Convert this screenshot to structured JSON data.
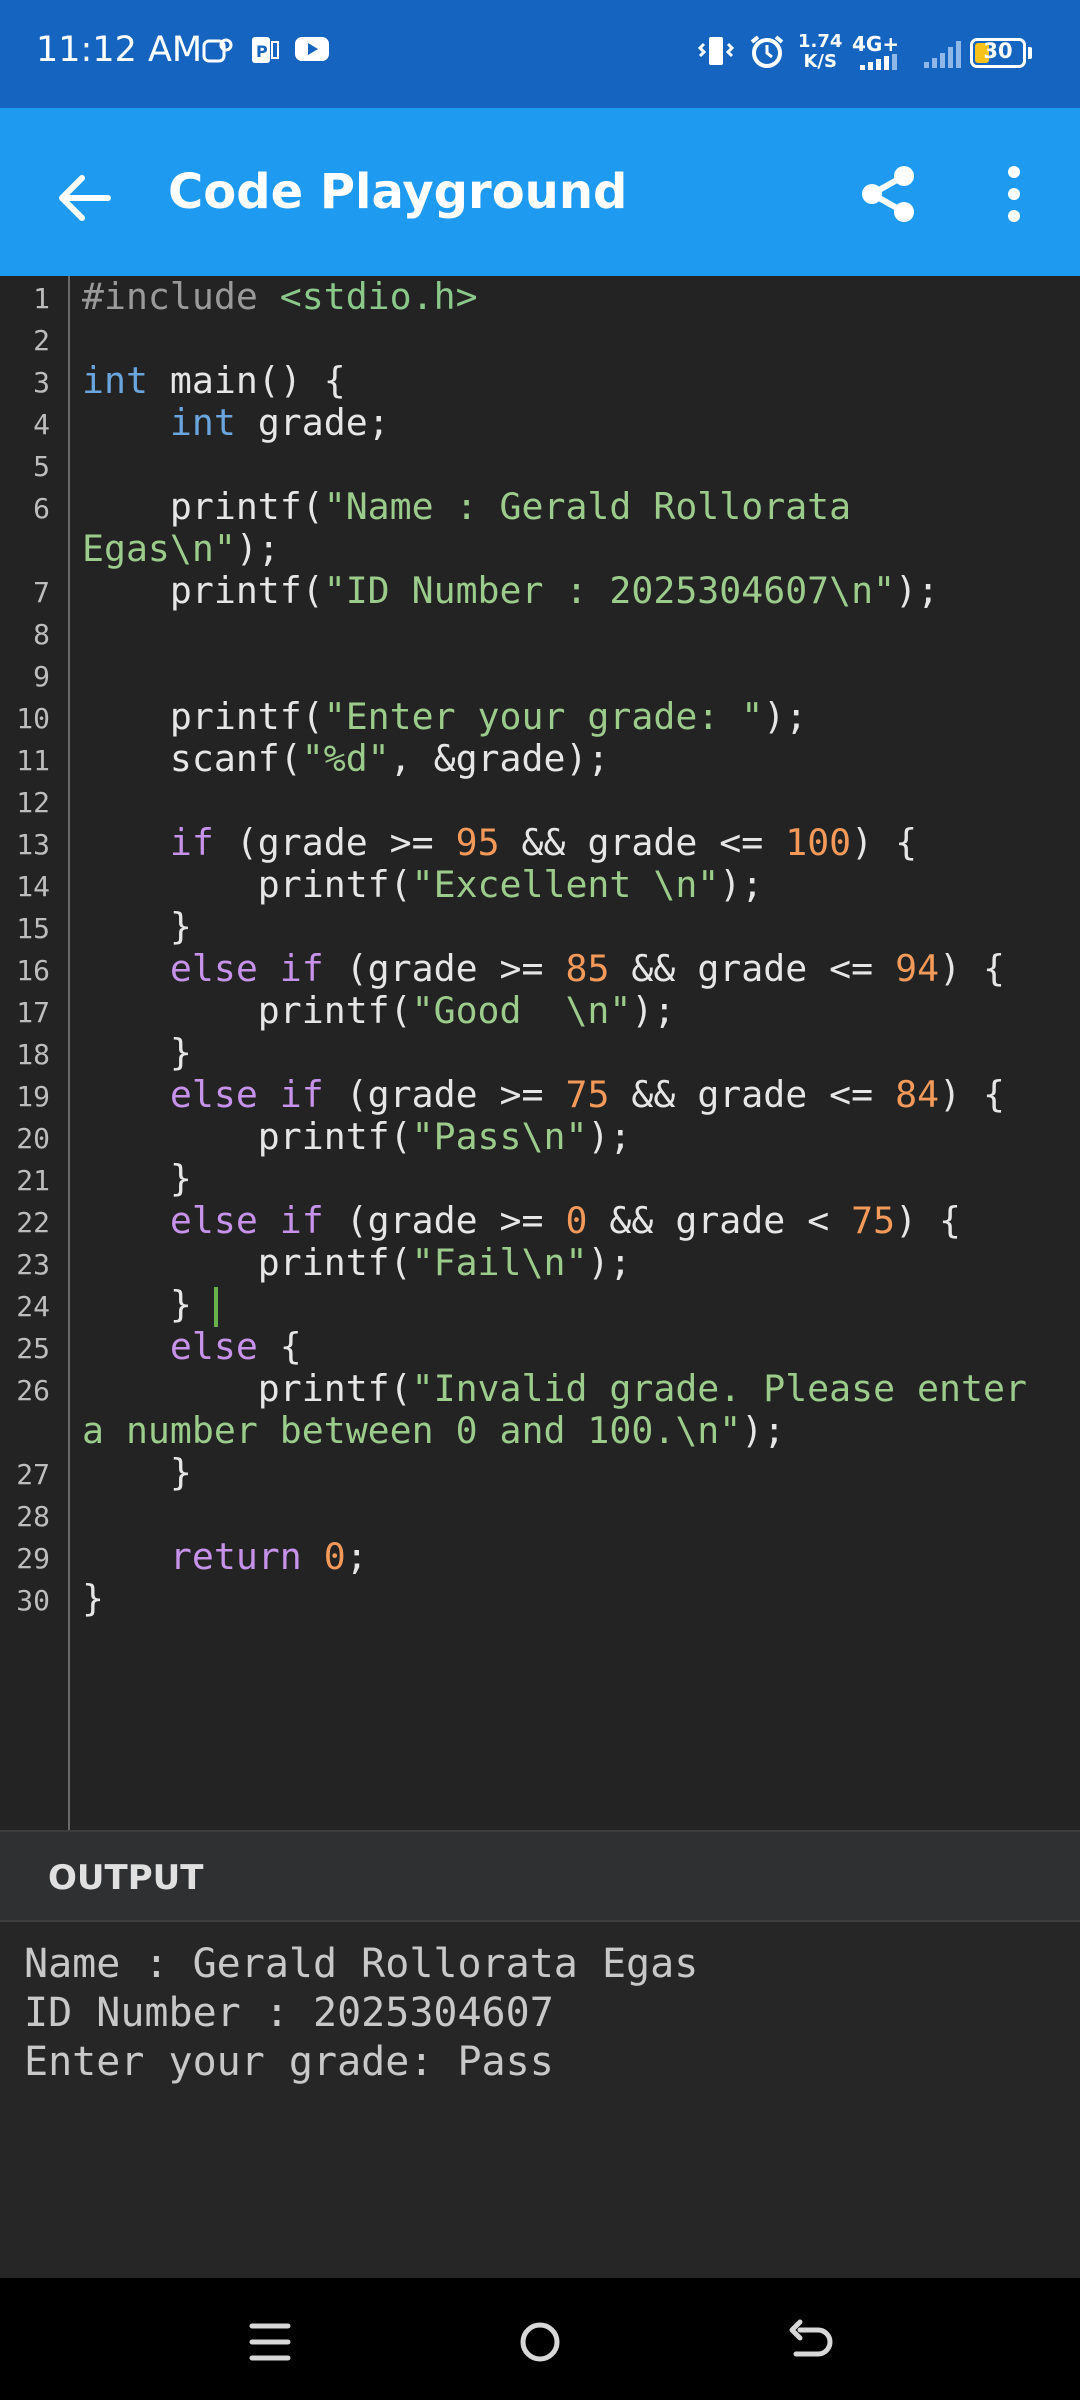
{
  "status_bar": {
    "time": "11:12 AM",
    "speed_value": "1.74",
    "speed_unit": "K/S",
    "network": "4G+",
    "battery": "30",
    "battery_level": 0.3,
    "battery_color": "#f9c21b",
    "icons": [
      "teams-icon",
      "powerpoint-icon",
      "youtube-icon",
      "vibrate-icon",
      "alarm-icon",
      "signal-icon",
      "signal-weak-icon",
      "battery-icon"
    ]
  },
  "app_bar": {
    "title": "Code Playground",
    "color": "#1e9bf0",
    "icons": [
      "back-arrow-icon",
      "share-icon",
      "more-vert-icon"
    ]
  },
  "editor": {
    "line_numbers": [
      "1",
      "2",
      "3",
      "4",
      "5",
      "6",
      "7",
      "8",
      "9",
      "10",
      "11",
      "12",
      "13",
      "14",
      "15",
      "16",
      "17",
      "18",
      "19",
      "20",
      "21",
      "22",
      "23",
      "24",
      "25",
      "26",
      "27",
      "28",
      "29",
      "30"
    ],
    "code": {
      "l1_directive": "#include",
      "l1_header": " <stdio.h>",
      "l3_type": "int",
      "l3_rest": " main() {",
      "l4_indent": "    ",
      "l4_type": "int",
      "l4_rest": " grade;",
      "l6_fn": "    printf(",
      "l6_str": "\"Name : Gerald Rollorata",
      "l6b_str": "Egas\\n\"",
      "l6b_rest": ");",
      "l7_fn": "    printf(",
      "l7_str": "\"ID Number : 2025304607\\n\"",
      "l7_rest": ");",
      "l10_fn": "    printf(",
      "l10_str": "\"Enter your grade: \"",
      "l10_rest": ");",
      "l11_fn": "    scanf(",
      "l11_str": "\"%d\"",
      "l11_rest": ", &grade);",
      "l13_indent": "    ",
      "l13_kw": "if",
      "l13_a": " (grade >= ",
      "l13_n1": "95",
      "l13_b": " && grade <= ",
      "l13_n2": "100",
      "l13_c": ") {",
      "l14_fn": "        printf(",
      "l14_str": "\"Excellent \\n\"",
      "l14_rest": ");",
      "l15": "    }",
      "l16_indent": "    ",
      "l16_kw": "else if",
      "l16_a": " (grade >= ",
      "l16_n1": "85",
      "l16_b": " && grade <= ",
      "l16_n2": "94",
      "l16_c": ") {",
      "l17_fn": "        printf(",
      "l17_str": "\"Good  \\n\"",
      "l17_rest": ");",
      "l18": "    }",
      "l19_indent": "    ",
      "l19_kw": "else if",
      "l19_a": " (grade >= ",
      "l19_n1": "75",
      "l19_b": " && grade <= ",
      "l19_n2": "84",
      "l19_c": ") {",
      "l20_fn": "        printf(",
      "l20_str": "\"Pass\\n\"",
      "l20_rest": ");",
      "l21": "    }",
      "l22_indent": "    ",
      "l22_kw": "else if",
      "l22_a": " (grade >= ",
      "l22_n1": "0",
      "l22_b": " && grade < ",
      "l22_n2": "75",
      "l22_c": ") {",
      "l23_fn": "        printf(",
      "l23_str": "\"Fail\\n\"",
      "l23_rest": ");",
      "l24": "    } ",
      "l25_indent": "    ",
      "l25_kw": "else",
      "l25_rest": " {",
      "l26_fn": "        printf(",
      "l26_str": "\"Invalid grade. Please enter",
      "l26b_str": "a number between 0 and 100.\\n\"",
      "l26b_rest": ");",
      "l27": "    }",
      "l29_indent": "    ",
      "l29_kw": "return",
      "l29_sp": " ",
      "l29_num": "0",
      "l29_rest": ";",
      "l30": "}"
    }
  },
  "output": {
    "label": "OUTPUT",
    "lines": [
      "Name : Gerald Rollorata Egas",
      "ID Number : 2025304607",
      "Enter your grade: Pass"
    ]
  },
  "nav_bar": {
    "icons": [
      "menu-icon",
      "home-icon",
      "back-icon"
    ]
  }
}
